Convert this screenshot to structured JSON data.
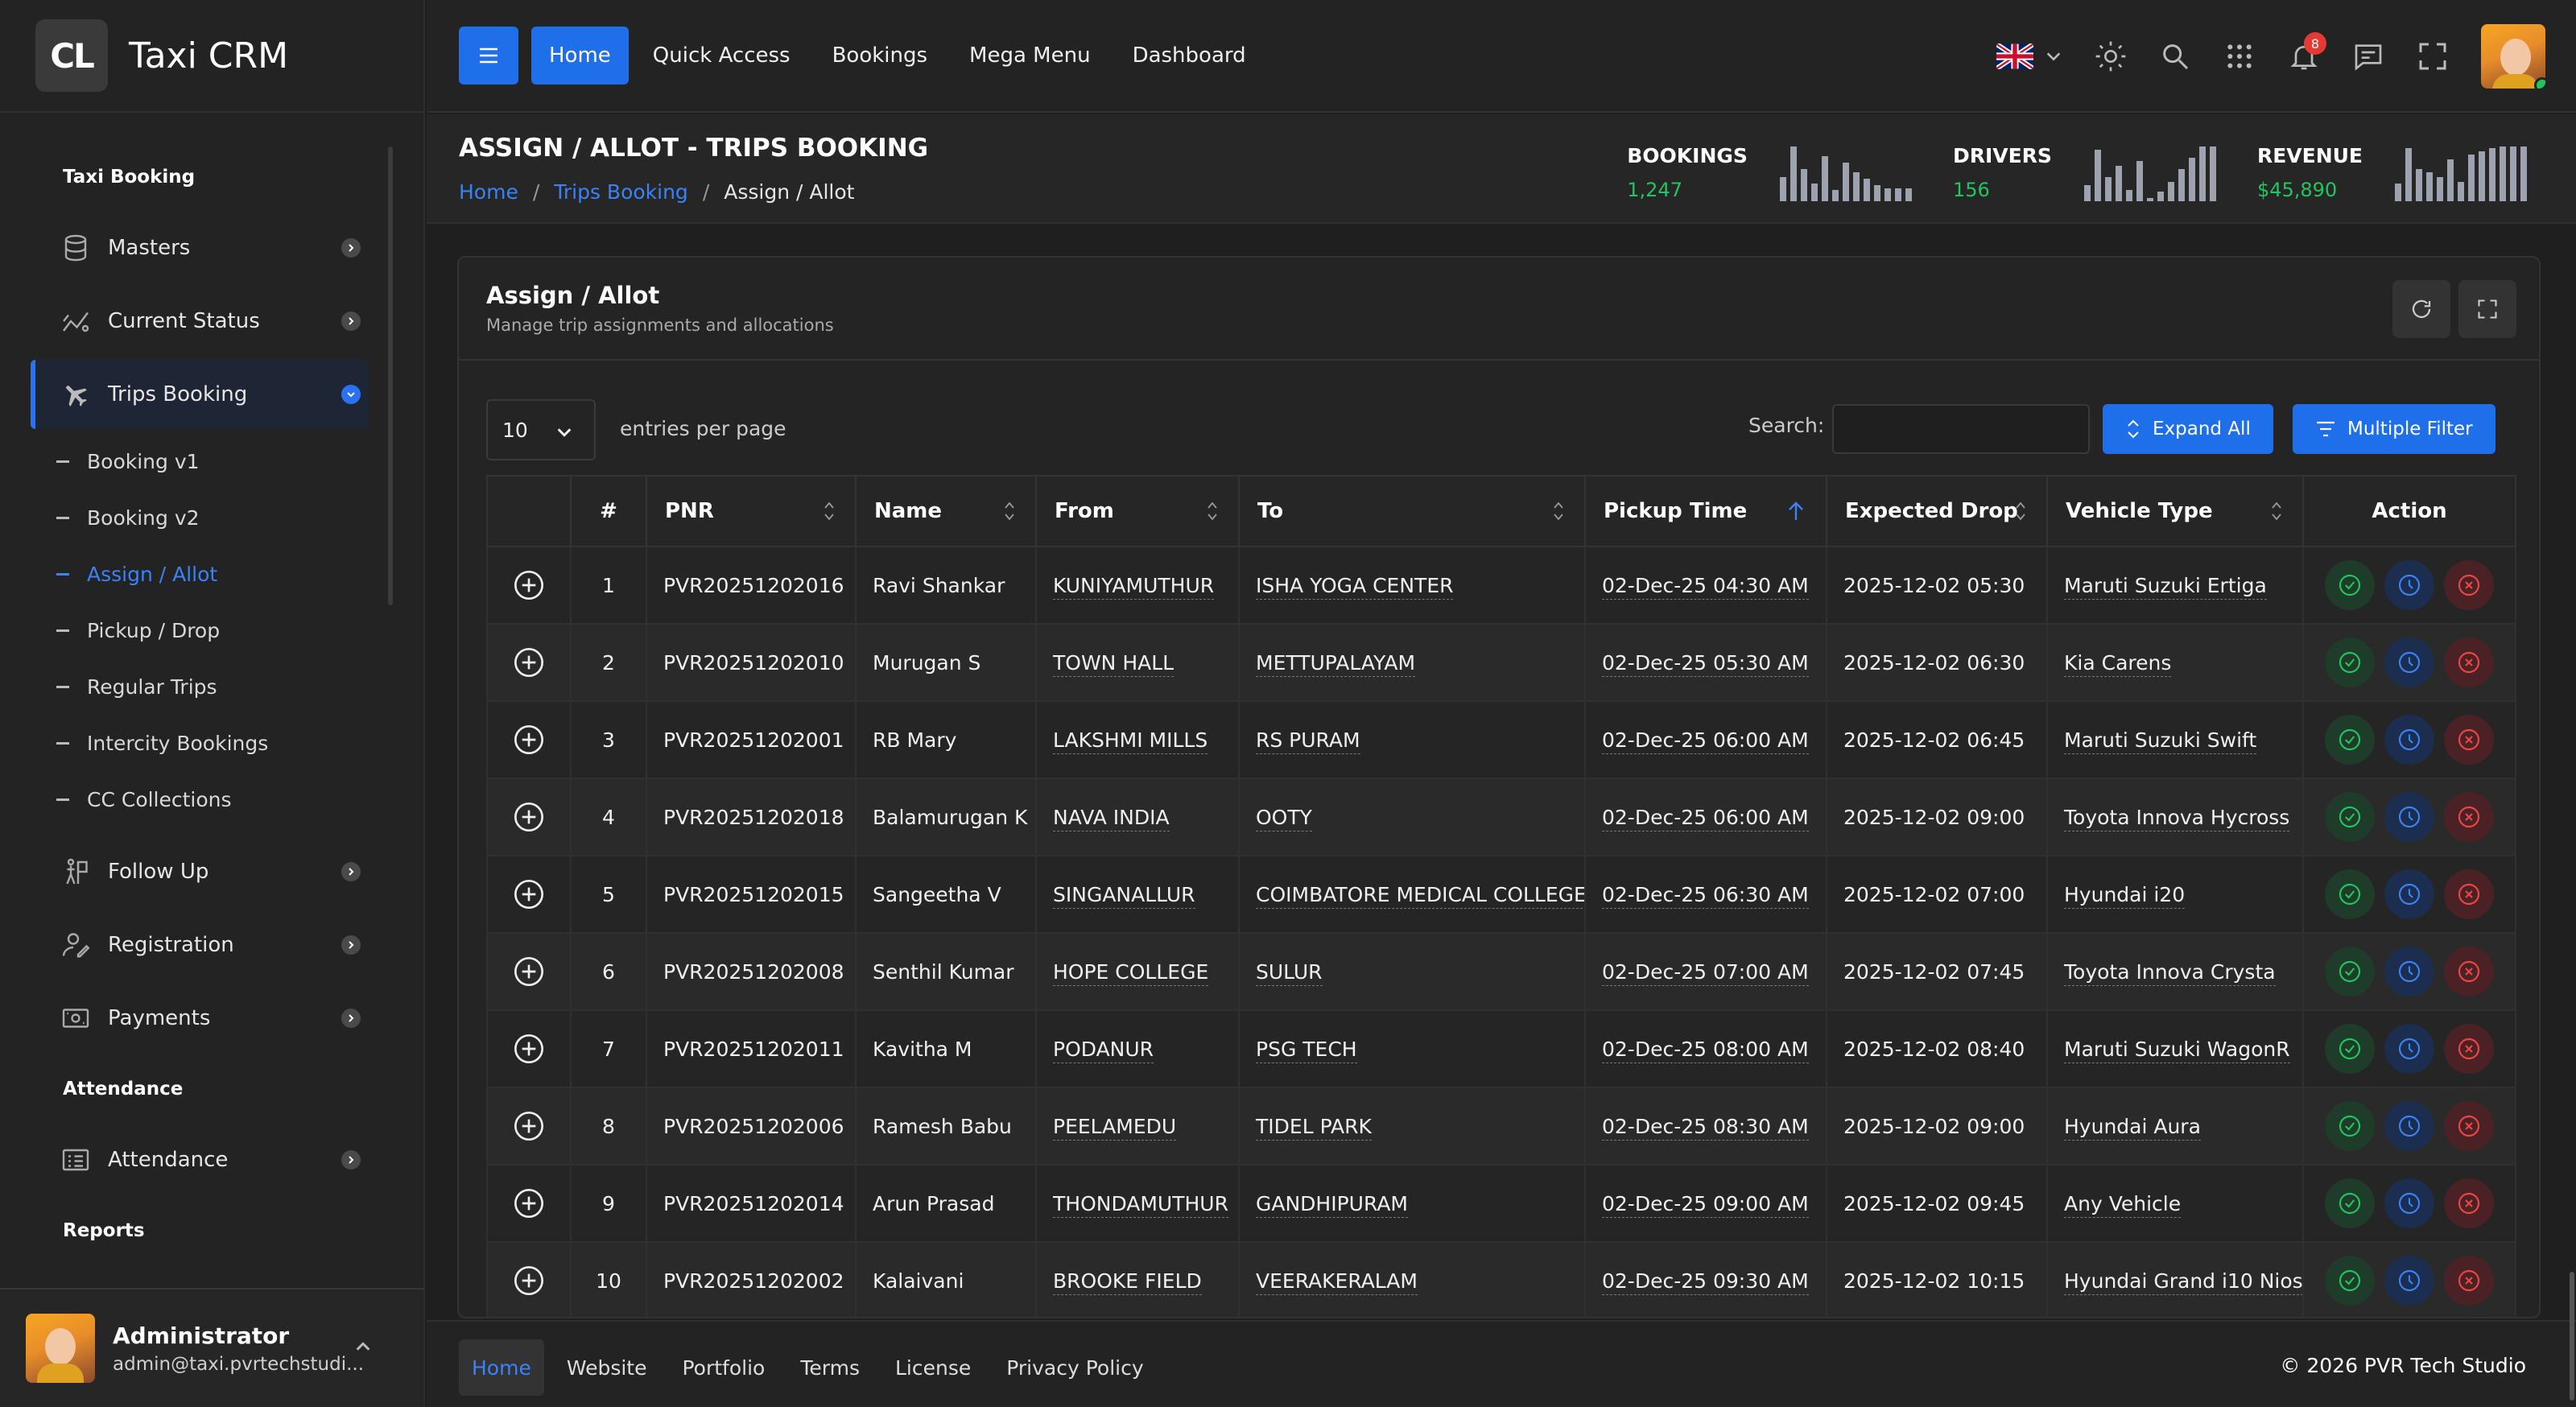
{
  "brand": {
    "logo_text": "CL",
    "name": "Taxi CRM"
  },
  "sidebar": {
    "section_taxi": "Taxi Booking",
    "items_top": [
      {
        "label": "Masters",
        "icon": "database-icon"
      },
      {
        "label": "Current Status",
        "icon": "chart-line-icon"
      },
      {
        "label": "Trips Booking",
        "icon": "plane-icon"
      }
    ],
    "sub_items": [
      "Booking v1",
      "Booking v2",
      "Assign / Allot",
      "Pickup / Drop",
      "Regular Trips",
      "Intercity Bookings",
      "CC Collections"
    ],
    "items_mid": [
      {
        "label": "Follow Up",
        "icon": "follow-up-icon"
      },
      {
        "label": "Registration",
        "icon": "user-register-icon"
      },
      {
        "label": "Payments",
        "icon": "payments-icon"
      }
    ],
    "section_attendance": "Attendance",
    "attendance_item": "Attendance",
    "section_reports": "Reports",
    "user": {
      "name": "Administrator",
      "email": "admin@taxi.pvrtechstudi..."
    }
  },
  "topbar": {
    "nav": [
      "Home",
      "Quick Access",
      "Bookings",
      "Mega Menu",
      "Dashboard"
    ],
    "notification_count": "8"
  },
  "page": {
    "title": "ASSIGN / ALLOT - TRIPS BOOKING",
    "breadcrumb": [
      "Home",
      "Trips Booking",
      "Assign / Allot"
    ],
    "stats": [
      {
        "label": "BOOKINGS",
        "value": "1,247"
      },
      {
        "label": "DRIVERS",
        "value": "156"
      },
      {
        "label": "REVENUE",
        "value": "$45,890"
      }
    ]
  },
  "card": {
    "title": "Assign / Allot",
    "subtitle": "Manage trip assignments and allocations",
    "entries_value": "10",
    "entries_label": "entries per page",
    "search_label": "Search:",
    "search_value": "",
    "expand_all": "Expand All",
    "multiple_filter": "Multiple Filter"
  },
  "table": {
    "headers": [
      "#",
      "PNR",
      "Name",
      "From",
      "To",
      "Pickup Time",
      "Expected Drop",
      "Vehicle Type",
      "Action"
    ],
    "rows": [
      {
        "n": "1",
        "pnr": "PVR20251202016",
        "name": "Ravi Shankar",
        "from": "KUNIYAMUTHUR",
        "to": "ISHA YOGA CENTER",
        "pickup": "02-Dec-25 04:30 AM",
        "drop": "2025-12-02 05:30",
        "vehicle": "Maruti Suzuki Ertiga"
      },
      {
        "n": "2",
        "pnr": "PVR20251202010",
        "name": "Murugan S",
        "from": "TOWN HALL",
        "to": "METTUPALAYAM",
        "pickup": "02-Dec-25 05:30 AM",
        "drop": "2025-12-02 06:30",
        "vehicle": "Kia Carens"
      },
      {
        "n": "3",
        "pnr": "PVR20251202001",
        "name": "RB Mary",
        "from": "LAKSHMI MILLS",
        "to": "RS PURAM",
        "pickup": "02-Dec-25 06:00 AM",
        "drop": "2025-12-02 06:45",
        "vehicle": "Maruti Suzuki Swift"
      },
      {
        "n": "4",
        "pnr": "PVR20251202018",
        "name": "Balamurugan K",
        "from": "NAVA INDIA",
        "to": "OOTY",
        "pickup": "02-Dec-25 06:00 AM",
        "drop": "2025-12-02 09:00",
        "vehicle": "Toyota Innova Hycross"
      },
      {
        "n": "5",
        "pnr": "PVR20251202015",
        "name": "Sangeetha V",
        "from": "SINGANALLUR",
        "to": "COIMBATORE MEDICAL COLLEGE",
        "pickup": "02-Dec-25 06:30 AM",
        "drop": "2025-12-02 07:00",
        "vehicle": "Hyundai i20"
      },
      {
        "n": "6",
        "pnr": "PVR20251202008",
        "name": "Senthil Kumar",
        "from": "HOPE COLLEGE",
        "to": "SULUR",
        "pickup": "02-Dec-25 07:00 AM",
        "drop": "2025-12-02 07:45",
        "vehicle": "Toyota Innova Crysta"
      },
      {
        "n": "7",
        "pnr": "PVR20251202011",
        "name": "Kavitha M",
        "from": "PODANUR",
        "to": "PSG TECH",
        "pickup": "02-Dec-25 08:00 AM",
        "drop": "2025-12-02 08:40",
        "vehicle": "Maruti Suzuki WagonR"
      },
      {
        "n": "8",
        "pnr": "PVR20251202006",
        "name": "Ramesh Babu",
        "from": "PEELAMEDU",
        "to": "TIDEL PARK",
        "pickup": "02-Dec-25 08:30 AM",
        "drop": "2025-12-02 09:00",
        "vehicle": "Hyundai Aura"
      },
      {
        "n": "9",
        "pnr": "PVR20251202014",
        "name": "Arun Prasad",
        "from": "THONDAMUTHUR",
        "to": "GANDHIPURAM",
        "pickup": "02-Dec-25 09:00 AM",
        "drop": "2025-12-02 09:45",
        "vehicle": "Any Vehicle"
      },
      {
        "n": "10",
        "pnr": "PVR20251202002",
        "name": "Kalaivani",
        "from": "BROOKE FIELD",
        "to": "VEERAKERALAM",
        "pickup": "02-Dec-25 09:30 AM",
        "drop": "2025-12-02 10:15",
        "vehicle": "Hyundai Grand i10 Nios"
      }
    ]
  },
  "footer": {
    "links": [
      "Home",
      "Website",
      "Portfolio",
      "Terms",
      "License",
      "Privacy Policy"
    ],
    "copyright": "© 2026  PVR Tech Studio"
  },
  "colors": {
    "accent": "#1f6feb",
    "success": "#22c55e",
    "danger": "#ef4444"
  }
}
